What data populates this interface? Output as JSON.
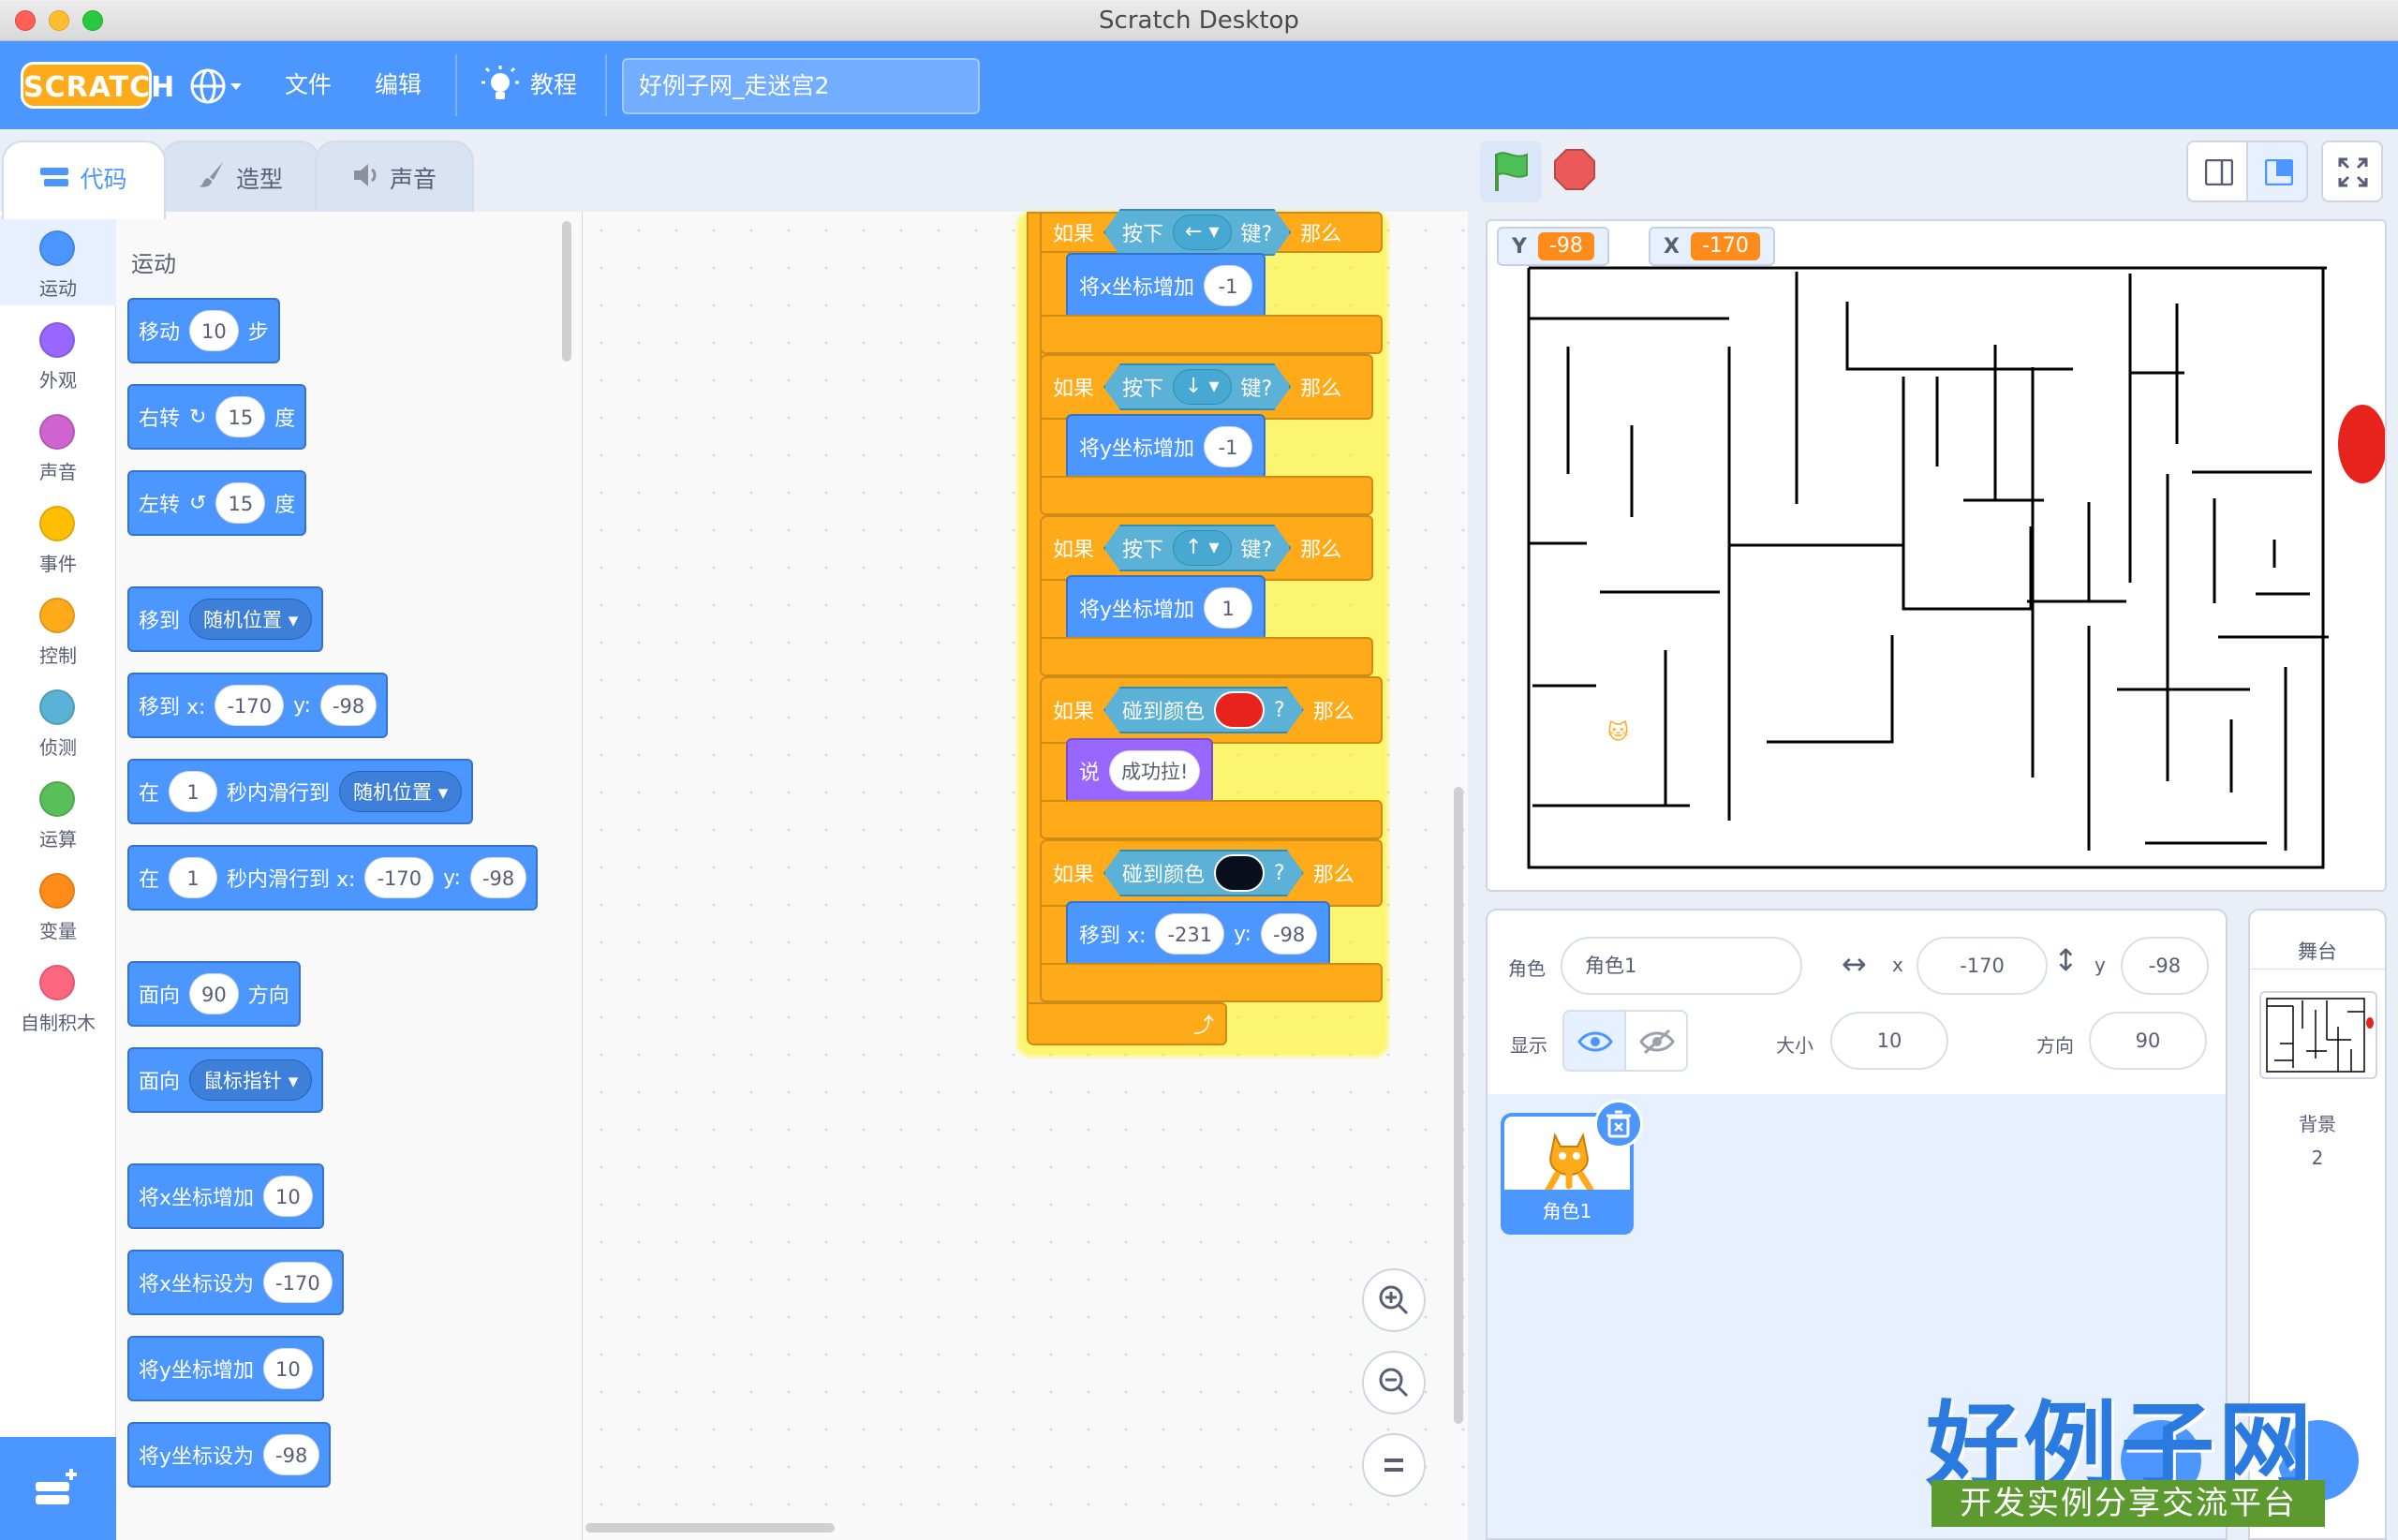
{
  "window": {
    "title": "Scratch Desktop"
  },
  "menubar": {
    "logo": "SCRATCH",
    "file": "文件",
    "edit": "编辑",
    "tutorials": "教程",
    "project_title": "好例子网_走迷宫2"
  },
  "tabs": {
    "code": "代码",
    "costumes": "造型",
    "sounds": "声音"
  },
  "categories": [
    {
      "label": "运动",
      "color": "#4c97ff"
    },
    {
      "label": "外观",
      "color": "#9966ff"
    },
    {
      "label": "声音",
      "color": "#cf63cf"
    },
    {
      "label": "事件",
      "color": "#ffbf00"
    },
    {
      "label": "控制",
      "color": "#ffab19"
    },
    {
      "label": "侦测",
      "color": "#5cb1d6"
    },
    {
      "label": "运算",
      "color": "#59c059"
    },
    {
      "label": "变量",
      "color": "#ff8c1a"
    },
    {
      "label": "自制积木",
      "color": "#ff6680"
    }
  ],
  "palette": {
    "heading": "运动",
    "move": {
      "pre": "移动",
      "val": "10",
      "post": "步"
    },
    "turn_right": {
      "pre": "右转",
      "val": "15",
      "post": "度"
    },
    "turn_left": {
      "pre": "左转",
      "val": "15",
      "post": "度"
    },
    "goto": {
      "pre": "移到",
      "drop": "随机位置"
    },
    "goto_xy": {
      "pre": "移到 x:",
      "x": "-170",
      "ylbl": "y:",
      "y": "-98"
    },
    "glide": {
      "pre": "在",
      "val": "1",
      "mid": "秒内滑行到",
      "drop": "随机位置"
    },
    "glide_xy": {
      "pre": "在",
      "val": "1",
      "mid": "秒内滑行到 x:",
      "x": "-170",
      "ylbl": "y:",
      "y": "-98"
    },
    "point_dir": {
      "pre": "面向",
      "val": "90",
      "post": "方向"
    },
    "point_towards": {
      "pre": "面向",
      "drop": "鼠标指针"
    },
    "change_x": {
      "pre": "将x坐标增加",
      "val": "10"
    },
    "set_x": {
      "pre": "将x坐标设为",
      "val": "-170"
    },
    "change_y": {
      "pre": "将y坐标增加",
      "val": "10"
    },
    "set_y": {
      "pre": "将y坐标设为",
      "val": "-98"
    }
  },
  "script": {
    "if_label": "如果",
    "then_label": "那么",
    "key_pressed": "按下",
    "key_suffix": "键?",
    "touch_color": "碰到颜色",
    "q": "?",
    "if1": {
      "key": "←",
      "action": "将x坐标增加",
      "val": "-1"
    },
    "if2": {
      "key": "↓",
      "action": "将y坐标增加",
      "val": "-1"
    },
    "if3": {
      "key": "↑",
      "action": "将y坐标增加",
      "val": "1"
    },
    "if4": {
      "color": "#e8231d",
      "say": "说",
      "say_val": "成功拉!"
    },
    "if5": {
      "color": "#0a0f1e",
      "action": "移到 x:",
      "x": "-231",
      "ylbl": "y:",
      "y": "-98"
    }
  },
  "stage": {
    "monitors": [
      {
        "label": "Y",
        "value": "-98"
      },
      {
        "label": "X",
        "value": "-170"
      }
    ],
    "target_color": "#e8231d"
  },
  "sprite_info": {
    "sprite_label": "角色",
    "sprite_name": "角色1",
    "x_label": "x",
    "x": "-170",
    "y_label": "y",
    "y": "-98",
    "show_label": "显示",
    "size_label": "大小",
    "size": "10",
    "direction_label": "方向",
    "direction": "90"
  },
  "sprites": [
    {
      "name": "角色1"
    }
  ],
  "stage_panel": {
    "title": "舞台",
    "backdrops_label": "背景",
    "backdrops_count": "2"
  },
  "watermark": {
    "title": "好例子网",
    "subtitle": "开发实例分享交流平台"
  }
}
